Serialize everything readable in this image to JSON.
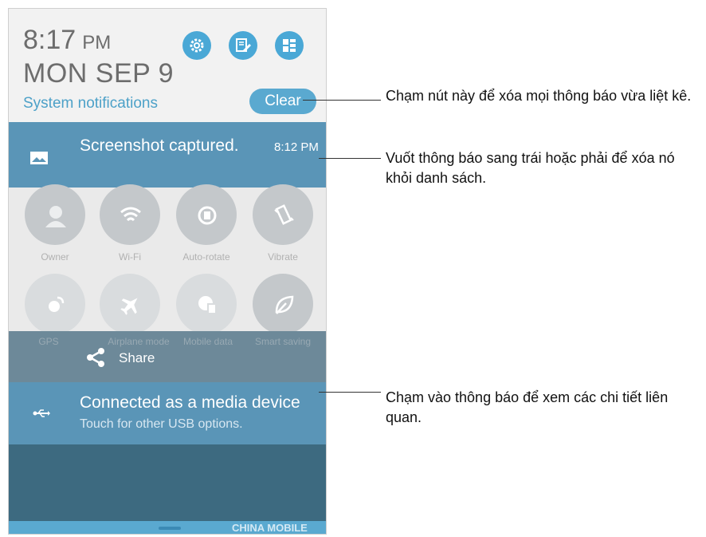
{
  "status": {
    "time": "8:17",
    "ampm": "PM",
    "date": "MON SEP 9",
    "system_label": "System notifications",
    "clear_label": "Clear"
  },
  "notification1": {
    "title": "Screenshot captured.",
    "time": "8:12 PM",
    "icon": "image-icon"
  },
  "tiles": [
    {
      "label": "Owner",
      "icon": "avatar-icon"
    },
    {
      "label": "Wi-Fi",
      "icon": "wifi-icon"
    },
    {
      "label": "Auto-rotate",
      "icon": "rotate-icon"
    },
    {
      "label": "Vibrate",
      "icon": "vibrate-icon"
    },
    {
      "label": "GPS",
      "icon": "gps-icon"
    },
    {
      "label": "Airplane mode",
      "icon": "airplane-icon"
    },
    {
      "label": "Mobile data",
      "icon": "mobile-data-icon"
    },
    {
      "label": "Smart saving",
      "icon": "leaf-icon"
    }
  ],
  "share": {
    "label": "Share",
    "icon": "share-icon"
  },
  "notification2": {
    "title": "Connected as a media device",
    "subtitle": "Touch for other USB options.",
    "icon": "usb-icon"
  },
  "navbar": {
    "carrier": "CHINA MOBILE"
  },
  "callouts": [
    {
      "text": "Chạm nút này để xóa mọi thông báo vừa liệt kê."
    },
    {
      "text": "Vuốt thông báo sang trái hoặc phải để xóa nó khỏi danh sách."
    },
    {
      "text": "Chạm vào thông báo để xem các chi tiết liên quan."
    }
  ],
  "colors": {
    "accent": "#4aa8d6",
    "notification": "#5a95b7",
    "dim": "#3d6a80"
  }
}
